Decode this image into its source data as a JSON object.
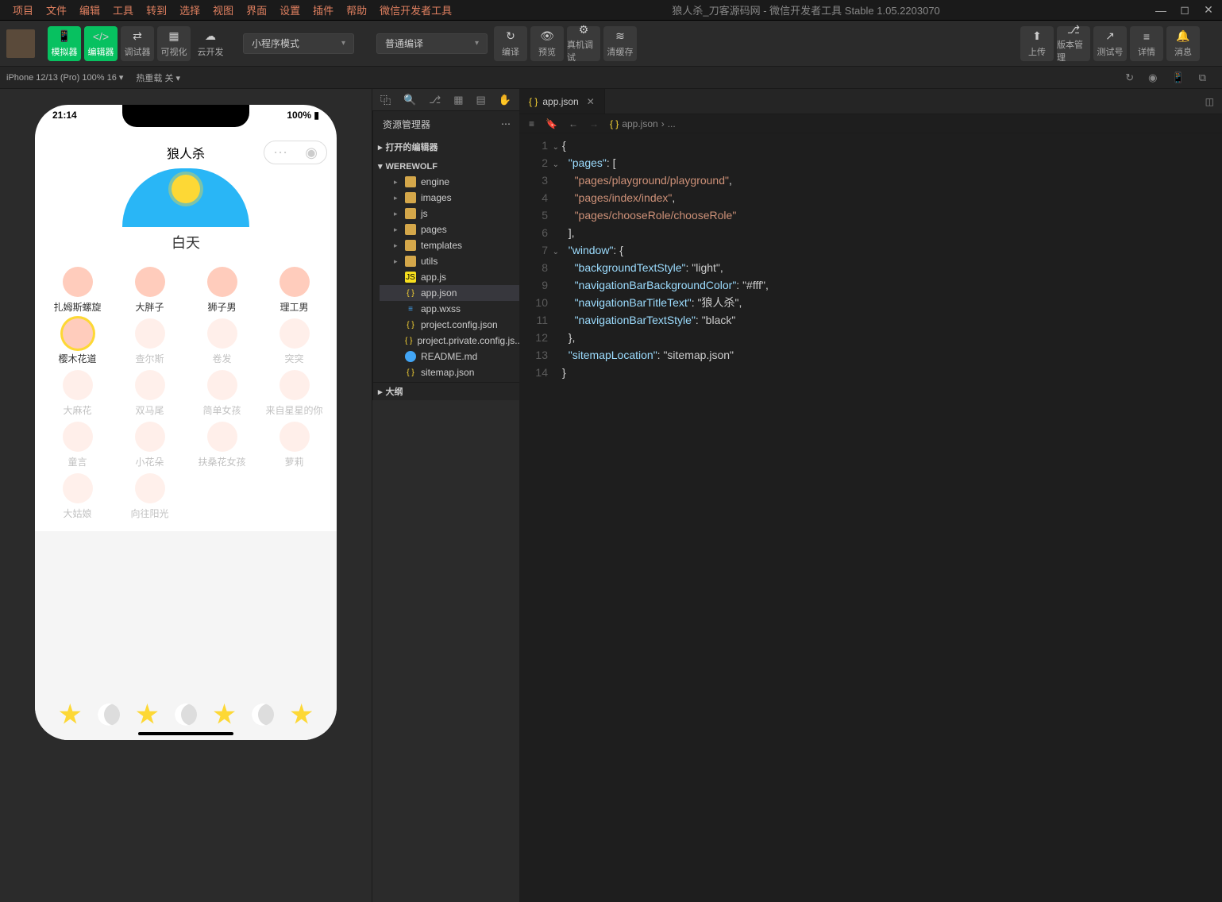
{
  "menubar": [
    "项目",
    "文件",
    "编辑",
    "工具",
    "转到",
    "选择",
    "视图",
    "界面",
    "设置",
    "插件",
    "帮助",
    "微信开发者工具"
  ],
  "windowTitle": "狼人杀_刀客源码网 - 微信开发者工具 Stable 1.05.2203070",
  "toolbar": {
    "simulator": "模拟器",
    "editor": "编辑器",
    "debugger": "调试器",
    "visual": "可视化",
    "cloud": "云开发",
    "modeDropdown": "小程序模式",
    "compileDropdown": "普通编译",
    "compile": "编译",
    "preview": "预览",
    "realDevice": "真机调试",
    "clearCache": "清缓存",
    "upload": "上传",
    "version": "版本管理",
    "testAccount": "测试号",
    "details": "详情",
    "messages": "消息"
  },
  "subbar": {
    "device": "iPhone 12/13 (Pro) 100% 16",
    "hotReload": "热重载 关"
  },
  "simulator": {
    "time": "21:14",
    "battery": "100%",
    "appTitle": "狼人杀",
    "dayLabel": "白天",
    "roles": [
      {
        "name": "扎姆斯螺旋",
        "dim": false,
        "sel": false
      },
      {
        "name": "大胖子",
        "dim": false,
        "sel": false
      },
      {
        "name": "狮子男",
        "dim": false,
        "sel": false
      },
      {
        "name": "理工男",
        "dim": false,
        "sel": false
      },
      {
        "name": "樱木花道",
        "dim": false,
        "sel": true
      },
      {
        "name": "查尔斯",
        "dim": true,
        "sel": false
      },
      {
        "name": "卷发",
        "dim": true,
        "sel": false
      },
      {
        "name": "突突",
        "dim": true,
        "sel": false
      },
      {
        "name": "大麻花",
        "dim": true,
        "sel": false
      },
      {
        "name": "双马尾",
        "dim": true,
        "sel": false
      },
      {
        "name": "简单女孩",
        "dim": true,
        "sel": false
      },
      {
        "name": "来自星星的你",
        "dim": true,
        "sel": false
      },
      {
        "name": "童言",
        "dim": true,
        "sel": false
      },
      {
        "name": "小花朵",
        "dim": true,
        "sel": false
      },
      {
        "name": "扶桑花女孩",
        "dim": true,
        "sel": false
      },
      {
        "name": "萝莉",
        "dim": true,
        "sel": false
      },
      {
        "name": "大姑娘",
        "dim": true,
        "sel": false
      },
      {
        "name": "向往阳光",
        "dim": true,
        "sel": false
      }
    ]
  },
  "explorer": {
    "title": "资源管理器",
    "openEditors": "打开的编辑器",
    "project": "WEREWOLF",
    "folders": [
      "engine",
      "images",
      "js",
      "pages",
      "templates",
      "utils"
    ],
    "files": [
      {
        "name": "app.js",
        "icon": "js"
      },
      {
        "name": "app.json",
        "icon": "json",
        "selected": true
      },
      {
        "name": "app.wxss",
        "icon": "wxss"
      },
      {
        "name": "project.config.json",
        "icon": "json"
      },
      {
        "name": "project.private.config.js...",
        "icon": "json"
      },
      {
        "name": "README.md",
        "icon": "md"
      },
      {
        "name": "sitemap.json",
        "icon": "json"
      }
    ],
    "outline": "大纲"
  },
  "editor": {
    "tabName": "app.json",
    "breadcrumb": "app.json",
    "breadcrumbExtra": "...",
    "code": {
      "l1": "{",
      "l2": "  \"pages\": [",
      "l3": "    \"pages/playground/playground\",",
      "l4": "    \"pages/index/index\",",
      "l5": "    \"pages/chooseRole/chooseRole\"",
      "l6": "  ],",
      "l7": "  \"window\": {",
      "l8": "    \"backgroundTextStyle\": \"light\",",
      "l9": "    \"navigationBarBackgroundColor\": \"#fff\",",
      "l10": "    \"navigationBarTitleText\": \"狼人杀\",",
      "l11": "    \"navigationBarTextStyle\": \"black\"",
      "l12": "  },",
      "l13": "  \"sitemapLocation\": \"sitemap.json\"",
      "l14": "}"
    }
  }
}
